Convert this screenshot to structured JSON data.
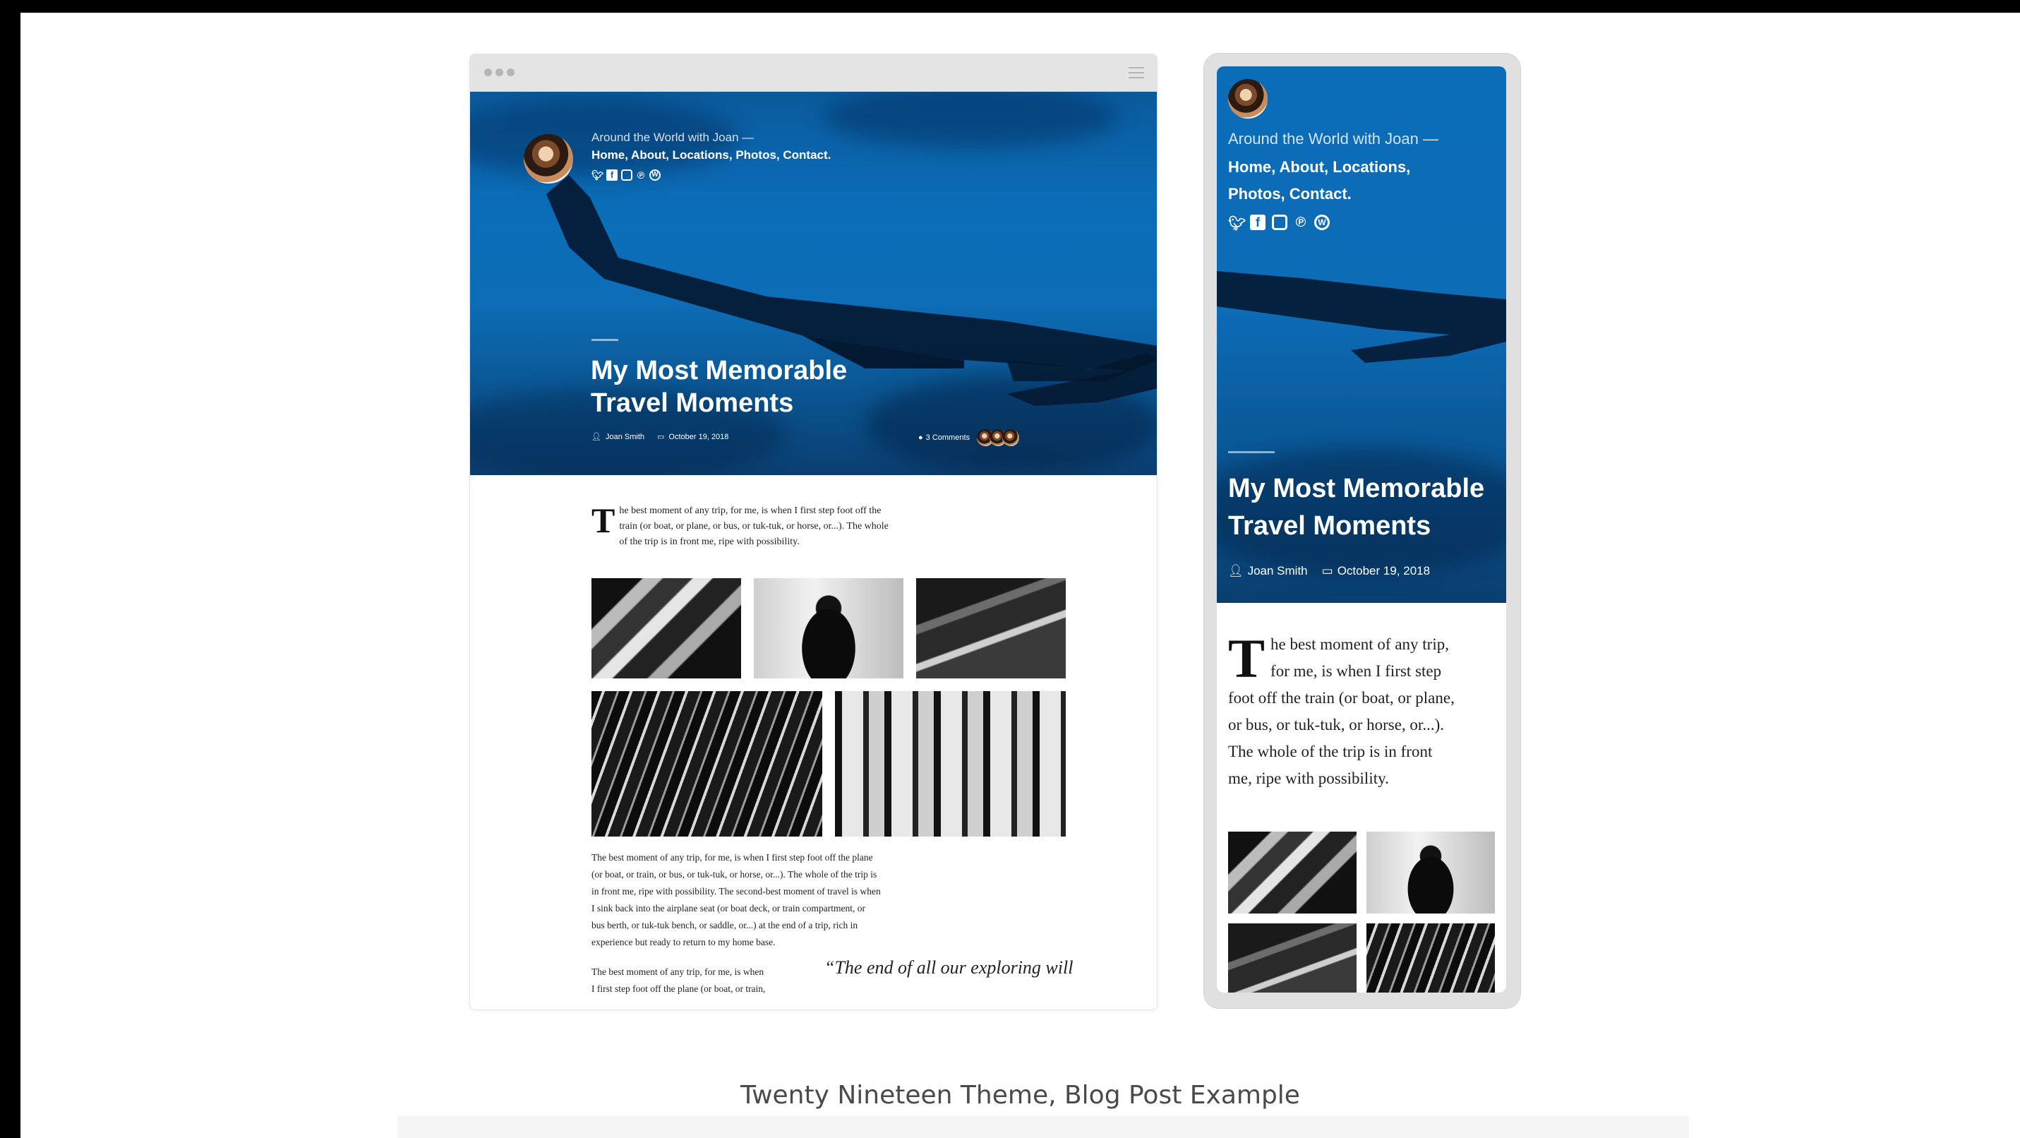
{
  "desktop": {
    "site_title": "Around the World with Joan —",
    "nav": "Home, About, Locations, Photos, Contact.",
    "post_title_line1": "My Most Memorable",
    "post_title_line2": "Travel Moments",
    "author": "Joan Smith",
    "date": "October 19, 2018",
    "comments": "3 Comments",
    "intro_dropcap": "T",
    "intro_line1": "he best moment of any trip, for me, is when I first step foot off the",
    "intro_line2": "train (or boat, or plane, or bus, or tuk-tuk, or horse, or...). The whole",
    "intro_line3": "of the trip is in front me, ripe with possibility.",
    "para_lines": [
      "The best moment of any trip, for me, is when I first step foot off the plane",
      "(or boat, or train, or bus, or tuk-tuk, or horse, or...). The whole of the trip is",
      "in front me, ripe with possibility. The second-best moment of travel is when",
      "I sink back into the airplane seat (or boat deck, or train compartment, or",
      "bus berth, or tuk-tuk bench, or saddle, or...) at the end of a trip, rich in",
      "experience but ready to return to my home base."
    ],
    "para2_line1": "The best moment of any trip, for me, is when",
    "para2_line2": "I first step foot off the plane (or boat, or train,",
    "quote": "“The end of all our exploring will"
  },
  "phone": {
    "site_title": "Around the World with Joan —",
    "nav_line1": "Home, About, Locations,",
    "nav_line2": "Photos, Contact.",
    "post_title_line1": "My Most Memorable",
    "post_title_line2": "Travel Moments",
    "author": "Joan Smith",
    "date": "October 19, 2018",
    "intro_dropcap": "T",
    "intro_lines": [
      "he best moment of any trip,",
      "for me, is when I first step",
      "foot off the train (or boat, or plane,",
      "or bus, or tuk-tuk, or horse, or...).",
      "The whole of the trip is in front",
      "me, ripe with possibility."
    ]
  },
  "social_icons": [
    "twitter-icon",
    "facebook-icon",
    "instagram-icon",
    "pinterest-icon",
    "wordpress-icon"
  ],
  "caption": "Twenty Nineteen Theme, Blog Post Example",
  "colors": {
    "hero_blue": "#0b6cb8",
    "text": "#222222",
    "caption": "#4a4a4a"
  }
}
